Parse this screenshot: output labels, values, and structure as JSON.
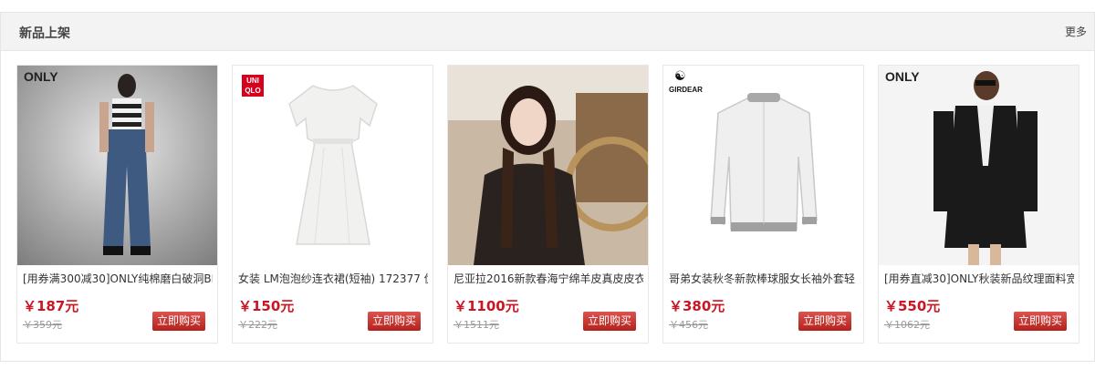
{
  "section": {
    "title": "新品上架",
    "more_label": "更多"
  },
  "buy_label": "立即购买",
  "products": [
    {
      "name": "[用券满300减30]ONLY纯棉磨白破洞BF",
      "price": "￥187元",
      "original_price": "￥359元",
      "brand": "ONLY"
    },
    {
      "name": "女装 LM泡泡纱连衣裙(短袖) 172377 优",
      "price": "￥150元",
      "original_price": "￥222元",
      "brand": "UNI QLO"
    },
    {
      "name": "尼亚拉2016新款春海宁绵羊皮真皮皮衣",
      "price": "￥1100元",
      "original_price": "￥1511元",
      "brand": ""
    },
    {
      "name": "哥弟女装秋冬新款棒球服女长袖外套轻",
      "price": "￥380元",
      "original_price": "￥456元",
      "brand": "GIRDEAR"
    },
    {
      "name": "[用券直减30]ONLY秋装新品纹理面料宽",
      "price": "￥550元",
      "original_price": "￥1062元",
      "brand": "ONLY"
    }
  ],
  "colors": {
    "price": "#c91623",
    "buy_button": "#c9302c",
    "header_bg": "#f3f3f3"
  }
}
